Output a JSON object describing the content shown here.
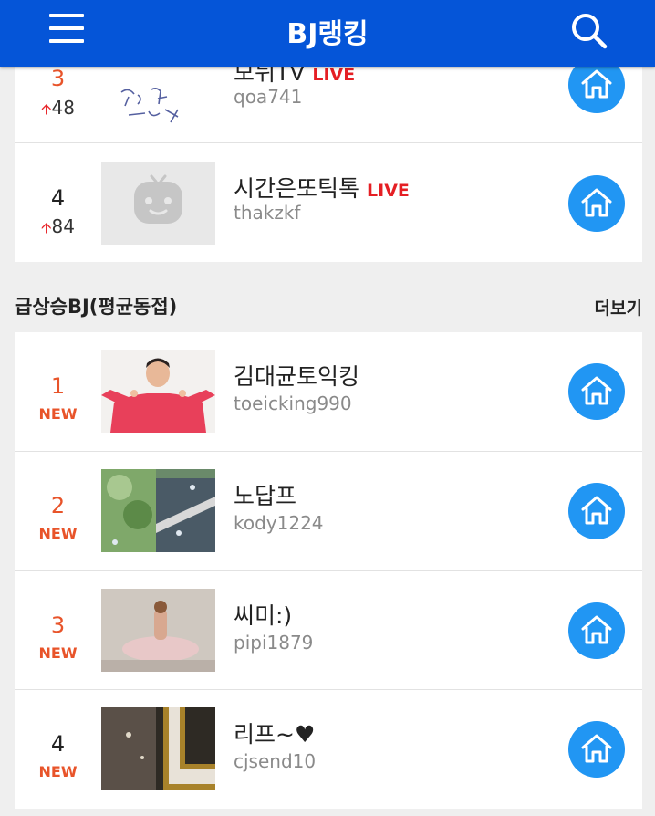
{
  "header": {
    "title": "BJ랭킹",
    "bg_color": "#0555d8"
  },
  "top_list": [
    {
      "rank": "3",
      "change": "48",
      "change_dir": "up",
      "name": "모뉘TV",
      "live": "LIVE",
      "uid": "qoa741"
    },
    {
      "rank": "4",
      "change": "84",
      "change_dir": "up",
      "name": "시간은또틱톡",
      "live": "LIVE",
      "uid": "thakzkf"
    }
  ],
  "section": {
    "title": "급상승BJ(평균동접)",
    "more": "더보기"
  },
  "rising_list": [
    {
      "rank": "1",
      "badge": "NEW",
      "name": "김대균토익킹",
      "uid": "toeicking990"
    },
    {
      "rank": "2",
      "badge": "NEW",
      "name": "노답프",
      "uid": "kody1224"
    },
    {
      "rank": "3",
      "badge": "NEW",
      "name": "씨미:)",
      "uid": "pipi1879"
    },
    {
      "rank": "4",
      "badge": "NEW",
      "name": "리프~♥",
      "uid": "cjsend10"
    }
  ],
  "icons": {
    "menu": "hamburger-icon",
    "search": "search-icon",
    "home": "home-icon",
    "up_arrow": "arrow-up-icon"
  },
  "colors": {
    "accent": "#2196f3",
    "new": "#e8542a",
    "live": "#e51f24"
  }
}
